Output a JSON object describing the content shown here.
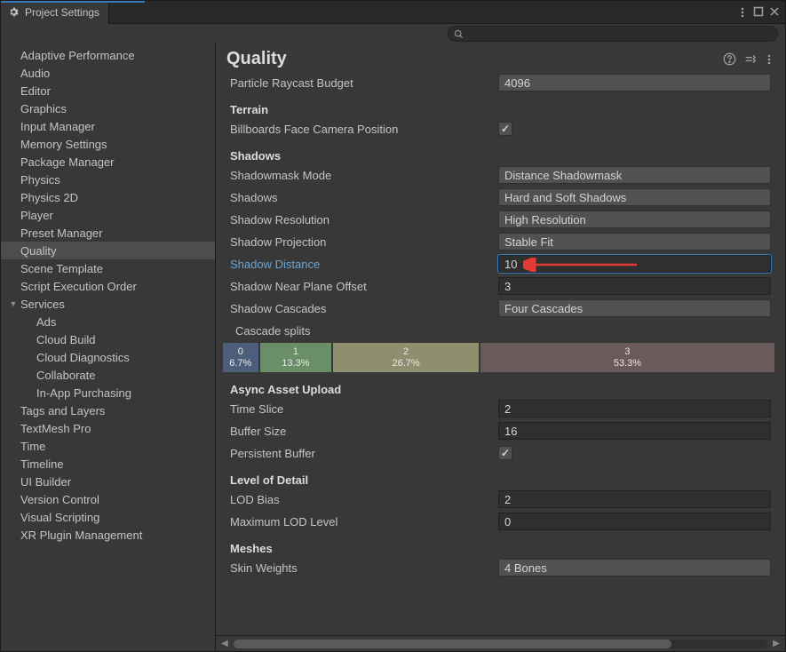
{
  "window": {
    "title": "Project Settings"
  },
  "search": {
    "placeholder": ""
  },
  "sidebar": {
    "items": [
      {
        "label": "Adaptive Performance",
        "kind": "item"
      },
      {
        "label": "Audio",
        "kind": "item"
      },
      {
        "label": "Editor",
        "kind": "item"
      },
      {
        "label": "Graphics",
        "kind": "item"
      },
      {
        "label": "Input Manager",
        "kind": "item"
      },
      {
        "label": "Memory Settings",
        "kind": "item"
      },
      {
        "label": "Package Manager",
        "kind": "item"
      },
      {
        "label": "Physics",
        "kind": "item"
      },
      {
        "label": "Physics 2D",
        "kind": "item"
      },
      {
        "label": "Player",
        "kind": "item"
      },
      {
        "label": "Preset Manager",
        "kind": "item"
      },
      {
        "label": "Quality",
        "kind": "item",
        "selected": true
      },
      {
        "label": "Scene Template",
        "kind": "item"
      },
      {
        "label": "Script Execution Order",
        "kind": "item"
      },
      {
        "label": "Services",
        "kind": "parent",
        "expanded": true
      },
      {
        "label": "Ads",
        "kind": "child"
      },
      {
        "label": "Cloud Build",
        "kind": "child"
      },
      {
        "label": "Cloud Diagnostics",
        "kind": "child"
      },
      {
        "label": "Collaborate",
        "kind": "child"
      },
      {
        "label": "In-App Purchasing",
        "kind": "child"
      },
      {
        "label": "Tags and Layers",
        "kind": "item"
      },
      {
        "label": "TextMesh Pro",
        "kind": "item"
      },
      {
        "label": "Time",
        "kind": "item"
      },
      {
        "label": "Timeline",
        "kind": "item"
      },
      {
        "label": "UI Builder",
        "kind": "item"
      },
      {
        "label": "Version Control",
        "kind": "item"
      },
      {
        "label": "Visual Scripting",
        "kind": "item"
      },
      {
        "label": "XR Plugin Management",
        "kind": "item"
      }
    ]
  },
  "page": {
    "title": "Quality",
    "props": {
      "particle_raycast_budget": {
        "label": "Particle Raycast Budget",
        "value": "4096"
      },
      "terrain_header": "Terrain",
      "billboards_face": {
        "label": "Billboards Face Camera Position",
        "checked": true
      },
      "shadows_header": "Shadows",
      "shadowmask_mode": {
        "label": "Shadowmask Mode",
        "value": "Distance Shadowmask"
      },
      "shadows": {
        "label": "Shadows",
        "value": "Hard and Soft Shadows"
      },
      "shadow_resolution": {
        "label": "Shadow Resolution",
        "value": "High Resolution"
      },
      "shadow_projection": {
        "label": "Shadow Projection",
        "value": "Stable Fit"
      },
      "shadow_distance": {
        "label": "Shadow Distance",
        "value": "10"
      },
      "shadow_near_plane": {
        "label": "Shadow Near Plane Offset",
        "value": "3"
      },
      "shadow_cascades": {
        "label": "Shadow Cascades",
        "value": "Four Cascades"
      },
      "cascade_splits_label": "Cascade splits",
      "cascade_splits": [
        {
          "n": "0",
          "p": "6.7%",
          "w": 6.7,
          "color": "#4d5e7a"
        },
        {
          "n": "1",
          "p": "13.3%",
          "w": 13.3,
          "color": "#6a8f68"
        },
        {
          "n": "2",
          "p": "26.7%",
          "w": 26.7,
          "color": "#8d8f6f"
        },
        {
          "n": "3",
          "p": "53.3%",
          "w": 53.3,
          "color": "#6a5a5a"
        }
      ],
      "async_header": "Async Asset Upload",
      "time_slice": {
        "label": "Time Slice",
        "value": "2"
      },
      "buffer_size": {
        "label": "Buffer Size",
        "value": "16"
      },
      "persistent_buffer": {
        "label": "Persistent Buffer",
        "checked": true
      },
      "lod_header": "Level of Detail",
      "lod_bias": {
        "label": "LOD Bias",
        "value": "2"
      },
      "max_lod_level": {
        "label": "Maximum LOD Level",
        "value": "0"
      },
      "meshes_header": "Meshes",
      "skin_weights": {
        "label": "Skin Weights",
        "value": "4 Bones"
      }
    }
  }
}
